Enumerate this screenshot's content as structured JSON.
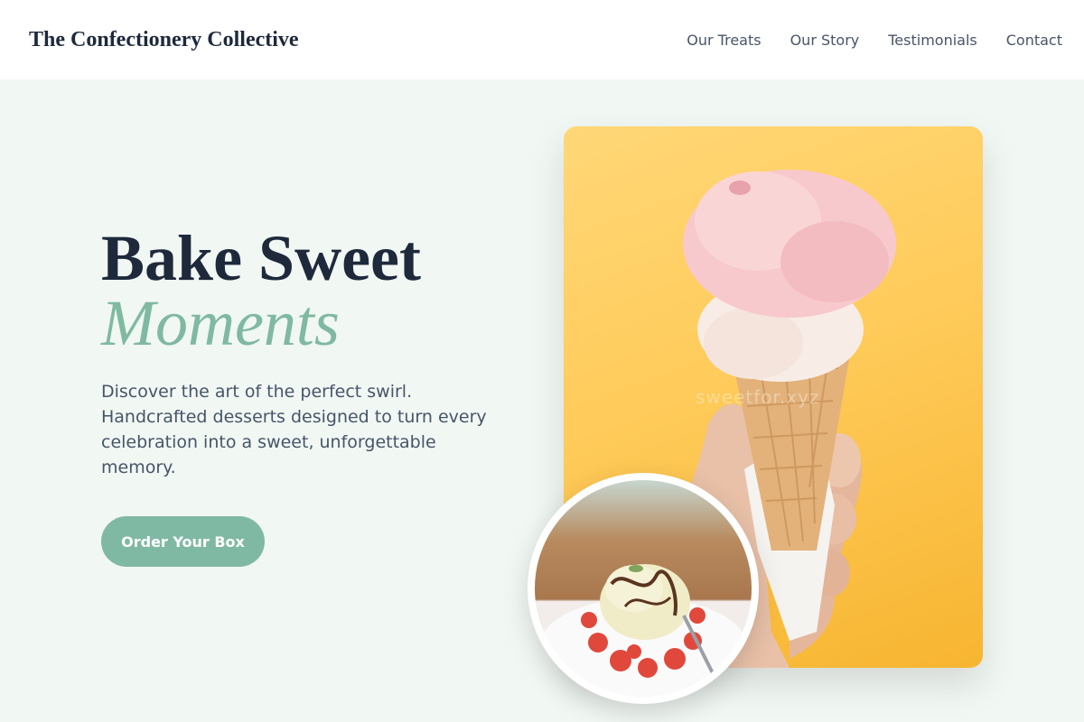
{
  "header": {
    "brand": "The Confectionery Collective",
    "nav": [
      "Our Treats",
      "Our Story",
      "Testimonials",
      "Contact"
    ]
  },
  "hero": {
    "title_line1": "Bake Sweet",
    "title_line2": "Moments",
    "description": "Discover the art of the perfect swirl. Handcrafted desserts designed to turn every celebration into a sweet, unforgettable memory.",
    "cta_label": "Order Your Box"
  },
  "images": {
    "main_photo_watermark": "sweetfor.xyz"
  },
  "colors": {
    "accent": "#80b9a3",
    "heading": "#1e293b",
    "body_text": "#475569",
    "background": "#f1f7f3",
    "photo_background": "#ffcb5a"
  }
}
